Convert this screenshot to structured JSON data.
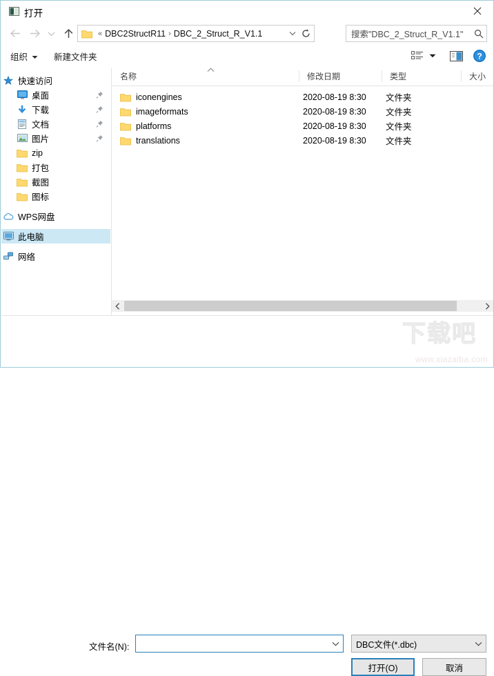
{
  "window": {
    "title": "打开",
    "icon": "app-open-icon",
    "close_label": "✕"
  },
  "nav": {
    "back": "←",
    "forward": "→",
    "recent": "⌄",
    "up": "↑"
  },
  "address": {
    "leading": "«",
    "separator": "›",
    "crumbs": [
      "DBC2StructR11",
      "DBC_2_Struct_R_V1.1"
    ],
    "dropdown": "⌄",
    "refresh": "⟳"
  },
  "search": {
    "placeholder": "搜索\"DBC_2_Struct_R_V1.1\"",
    "icon": "search-icon"
  },
  "toolbar": {
    "organize": "组织",
    "organize_caret": "▼",
    "new_folder": "新建文件夹",
    "view_caret": "▼",
    "view_icon": "view-list-icon",
    "preview_icon": "preview-pane-icon",
    "help_icon": "help-icon",
    "help_glyph": "?"
  },
  "sidebar": {
    "items": [
      {
        "label": "快速访问",
        "icon": "star-icon",
        "level": 0,
        "pinned": false,
        "selected": false
      },
      {
        "label": "桌面",
        "icon": "desktop-icon",
        "level": 1,
        "pinned": true,
        "selected": false
      },
      {
        "label": "下载",
        "icon": "download-icon",
        "level": 1,
        "pinned": true,
        "selected": false
      },
      {
        "label": "文档",
        "icon": "documents-icon",
        "level": 1,
        "pinned": true,
        "selected": false
      },
      {
        "label": "图片",
        "icon": "pictures-icon",
        "level": 1,
        "pinned": true,
        "selected": false
      },
      {
        "label": "zip",
        "icon": "folder-icon",
        "level": 1,
        "pinned": false,
        "selected": false
      },
      {
        "label": "打包",
        "icon": "folder-icon",
        "level": 1,
        "pinned": false,
        "selected": false
      },
      {
        "label": "截图",
        "icon": "folder-icon",
        "level": 1,
        "pinned": false,
        "selected": false
      },
      {
        "label": "图标",
        "icon": "folder-icon",
        "level": 1,
        "pinned": false,
        "selected": false
      },
      {
        "label": "WPS网盘",
        "icon": "cloud-icon",
        "level": 0,
        "pinned": false,
        "selected": false
      },
      {
        "label": "此电脑",
        "icon": "this-pc-icon",
        "level": 0,
        "pinned": false,
        "selected": true
      },
      {
        "label": "网络",
        "icon": "network-icon",
        "level": 0,
        "pinned": false,
        "selected": false
      }
    ]
  },
  "filelist": {
    "columns": [
      {
        "label": "名称",
        "sorted": "asc"
      },
      {
        "label": "修改日期",
        "sorted": ""
      },
      {
        "label": "类型",
        "sorted": ""
      },
      {
        "label": "大小",
        "sorted": ""
      }
    ],
    "sort_glyph": "^",
    "rows": [
      {
        "name": "iconengines",
        "date": "2020-08-19 8:30",
        "type": "文件夹",
        "size": "",
        "icon": "folder-icon"
      },
      {
        "name": "imageformats",
        "date": "2020-08-19 8:30",
        "type": "文件夹",
        "size": "",
        "icon": "folder-icon"
      },
      {
        "name": "platforms",
        "date": "2020-08-19 8:30",
        "type": "文件夹",
        "size": "",
        "icon": "folder-icon"
      },
      {
        "name": "translations",
        "date": "2020-08-19 8:30",
        "type": "文件夹",
        "size": "",
        "icon": "folder-icon"
      }
    ]
  },
  "scrollbar": {
    "left_arrow": "‹",
    "right_arrow": "›"
  },
  "form": {
    "filename_label": "文件名(N):",
    "filename_value": "",
    "filename_caret": "⌄",
    "filter_value": "DBC文件(*.dbc)",
    "filter_caret": "⌄",
    "open_button": "打开(O)",
    "cancel_button": "取消"
  },
  "watermark": {
    "brand": "下载吧",
    "url": "www.xiazaiba.com"
  },
  "colors": {
    "accent": "#2a80b9",
    "selection": "#cce8f5",
    "folder": "#ffd970",
    "border": "#9ecbd8"
  }
}
